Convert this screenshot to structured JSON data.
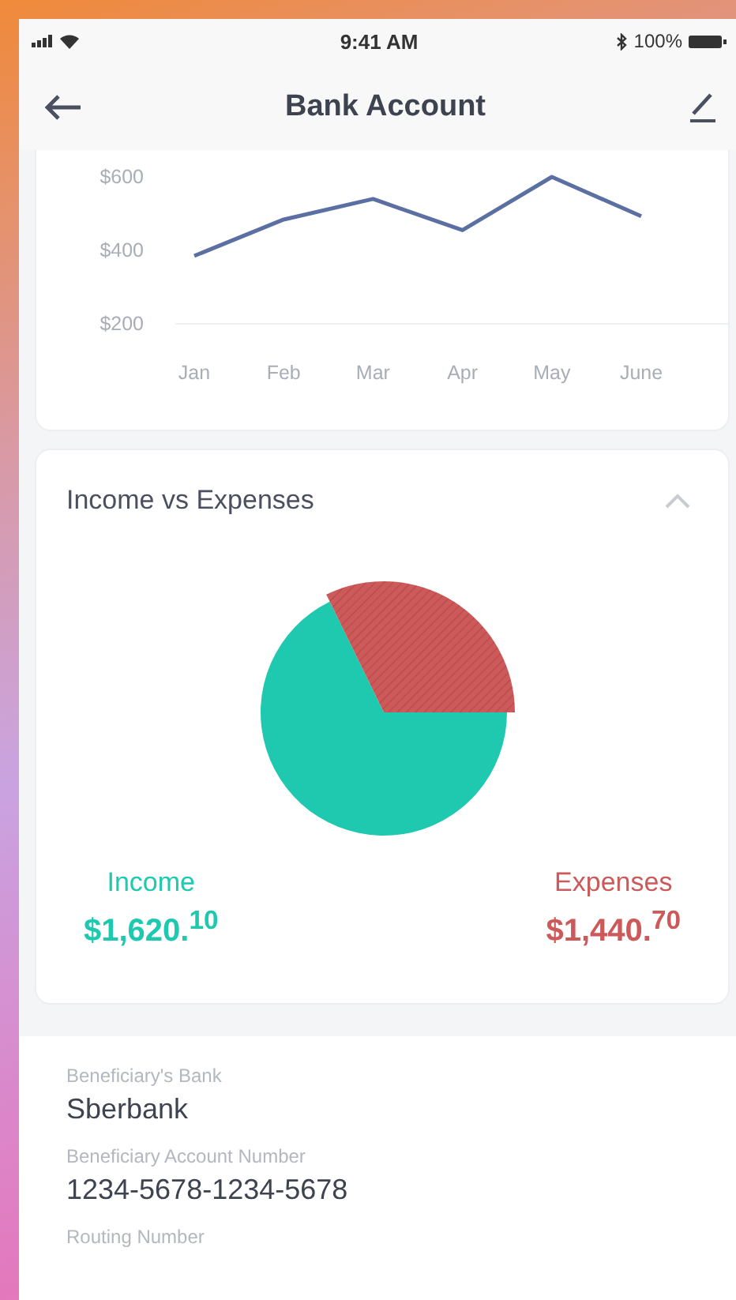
{
  "status_bar": {
    "time": "9:41 AM",
    "battery": "100%"
  },
  "nav": {
    "title": "Bank Account"
  },
  "balance_chart": {
    "chart_data": {
      "type": "line",
      "ylim": [
        200,
        600
      ],
      "categories": [
        "Jan",
        "Feb",
        "Mar",
        "Apr",
        "May",
        "June"
      ],
      "yticks": [
        {
          "value": 200,
          "label": "$200"
        },
        {
          "value": 400,
          "label": "$400"
        },
        {
          "value": 600,
          "label": "$600"
        }
      ],
      "series": [
        {
          "color": "#5b6fa3",
          "values": [
            385,
            484,
            540,
            455,
            600,
            493
          ]
        }
      ]
    }
  },
  "income_expenses": {
    "title": "Income vs Expenses",
    "expanded": true,
    "legend": [
      {
        "label": "Income",
        "amount": "$1,620.$^{10}$",
        "color": "#1ec9b0"
      },
      {
        "label": "Expenses",
        "amount": "$1,440.$^{70}$",
        "color": "#cc5a5a"
      }
    ]
  },
  "details": [
    {
      "label": "Beneficiary's Bank",
      "value": "Sberbank"
    },
    {
      "label": "Beneficiary Account Number",
      "value": "1234-5678-1234-5678"
    },
    {
      "label": "Routing Number"
    }
  ]
}
